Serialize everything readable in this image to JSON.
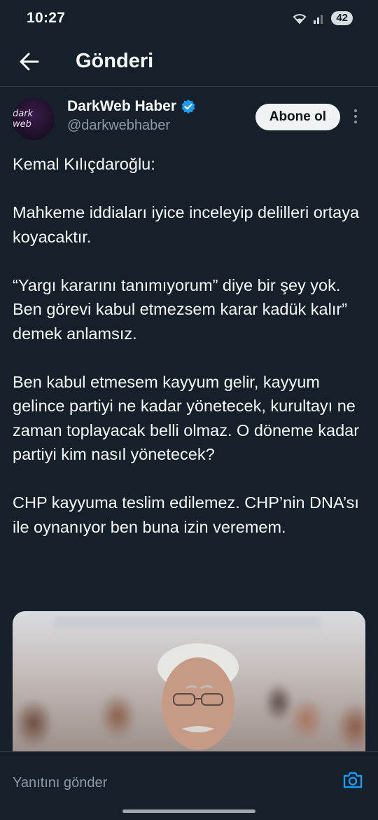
{
  "status_bar": {
    "time": "10:27",
    "battery": "42",
    "icons": [
      "wifi-icon",
      "signal-icon"
    ]
  },
  "header": {
    "title": "Gönderi",
    "back_icon": "arrow-left-icon"
  },
  "author": {
    "display_name": "DarkWeb Haber",
    "handle": "@darkwebhaber",
    "avatar_text": "dark web",
    "verified": true,
    "follow_label": "Abone ol"
  },
  "tweet": {
    "paragraphs": [
      "Kemal Kılıçdaroğlu:",
      "Mahkeme iddiaları iyice inceleyip delilleri ortaya koyacaktır.",
      "“Yargı kararını tanımıyorum” diye bir şey yok. Ben görevi kabul etmezsem karar kadük kalır” demek anlamsız.",
      "Ben kabul etmesem kayyum gelir, kayyum gelince partiyi ne kadar yönetecek, kurultayı ne zaman toplayacak belli olmaz. O döneme kadar partiyi kim nasıl yönetecek?",
      "CHP kayyuma teslim edilemez. CHP’nin DNA’sı ile oynanıyor ben buna izin veremem."
    ]
  },
  "reply": {
    "placeholder": "Yanıtını gönder"
  },
  "colors": {
    "background": "#15202b",
    "text": "#f7f9f9",
    "muted": "#8b98a5",
    "accent": "#1d9bf0"
  }
}
